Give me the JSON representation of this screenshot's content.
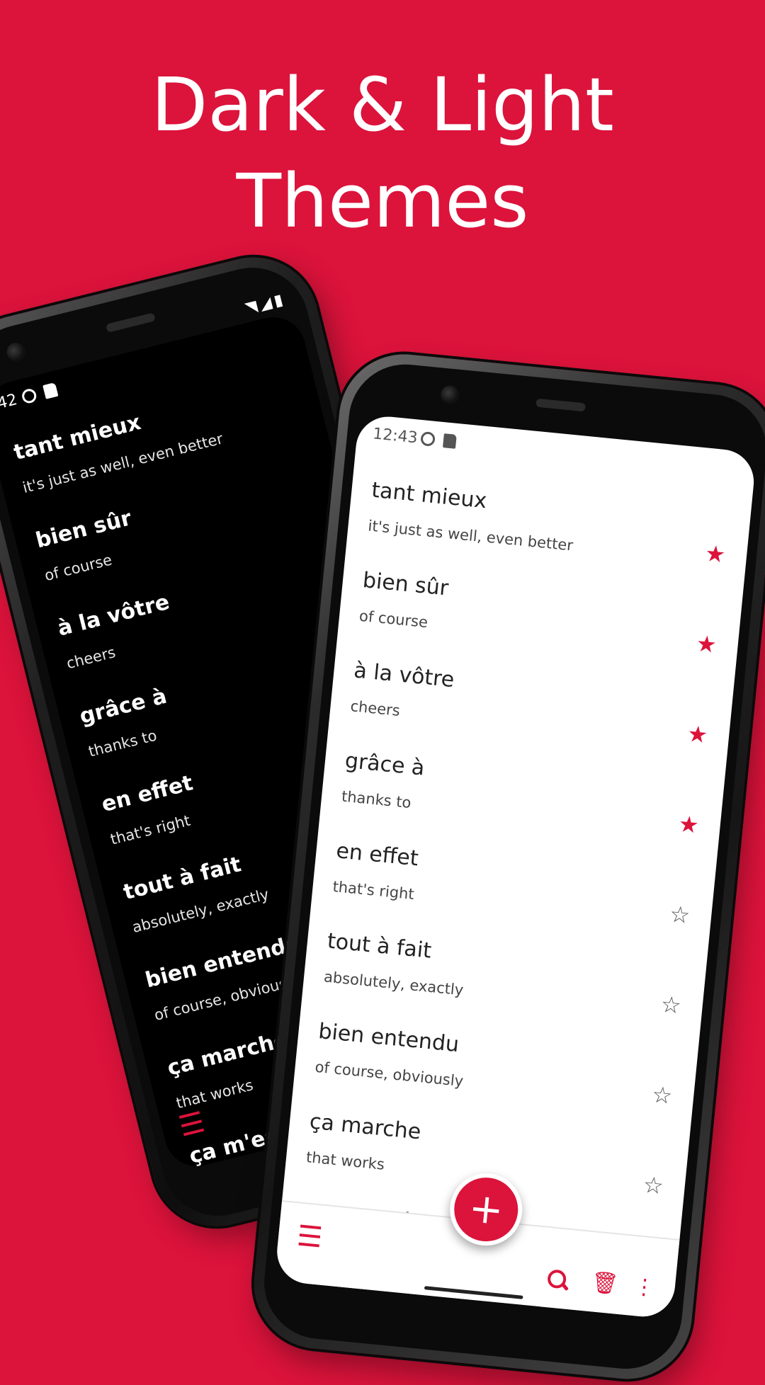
{
  "headline": {
    "line1": "Dark & Light",
    "line2": "Themes"
  },
  "colors": {
    "background": "#dc133b",
    "accent": "#dc133b",
    "dark_screen": "#000000",
    "light_screen": "#ffffff"
  },
  "dark_phone": {
    "status": {
      "time": "42",
      "icons": [
        "sync-icon",
        "sd-card-icon"
      ]
    },
    "system_icons": [
      "wifi-icon",
      "signal-icon",
      "battery-icon"
    ],
    "items": [
      {
        "term": "tant mieux",
        "definition": "it's just as well, even better"
      },
      {
        "term": "bien sûr",
        "definition": "of course"
      },
      {
        "term": "à la vôtre",
        "definition": "cheers"
      },
      {
        "term": "grâce à",
        "definition": "thanks to"
      },
      {
        "term": "en effet",
        "definition": "that's right"
      },
      {
        "term": "tout à fait",
        "definition": "absolutely, exactly"
      },
      {
        "term": "bien entendu",
        "definition": "of course, obviously"
      },
      {
        "term": "ça marche",
        "definition": "that works"
      },
      {
        "term": "ça m'est",
        "definition": ""
      }
    ],
    "bottom_menu_icon": "menu-icon"
  },
  "light_phone": {
    "status": {
      "time": "12:43",
      "icons": [
        "sync-icon",
        "sd-card-icon"
      ]
    },
    "items": [
      {
        "term": "tant mieux",
        "definition": "it's just as well, even better",
        "starred": true
      },
      {
        "term": "bien sûr",
        "definition": "of course",
        "starred": true
      },
      {
        "term": "à la vôtre",
        "definition": "cheers",
        "starred": true
      },
      {
        "term": "grâce à",
        "definition": "thanks to",
        "starred": true
      },
      {
        "term": "en effet",
        "definition": "that's right",
        "starred": false
      },
      {
        "term": "tout à fait",
        "definition": "absolutely, exactly",
        "starred": false
      },
      {
        "term": "bien entendu",
        "definition": "of course, obviously",
        "starred": false
      },
      {
        "term": "ça marche",
        "definition": "that works",
        "starred": false
      },
      {
        "term": "ça m'est égal",
        "definition": "",
        "starred": false
      }
    ],
    "bottom_bar": {
      "menu_icon": "menu-icon",
      "fab_icon": "add-icon",
      "search_icon": "search-icon",
      "delete_icon": "delete-icon",
      "more_icon": "more-vert-icon"
    }
  }
}
